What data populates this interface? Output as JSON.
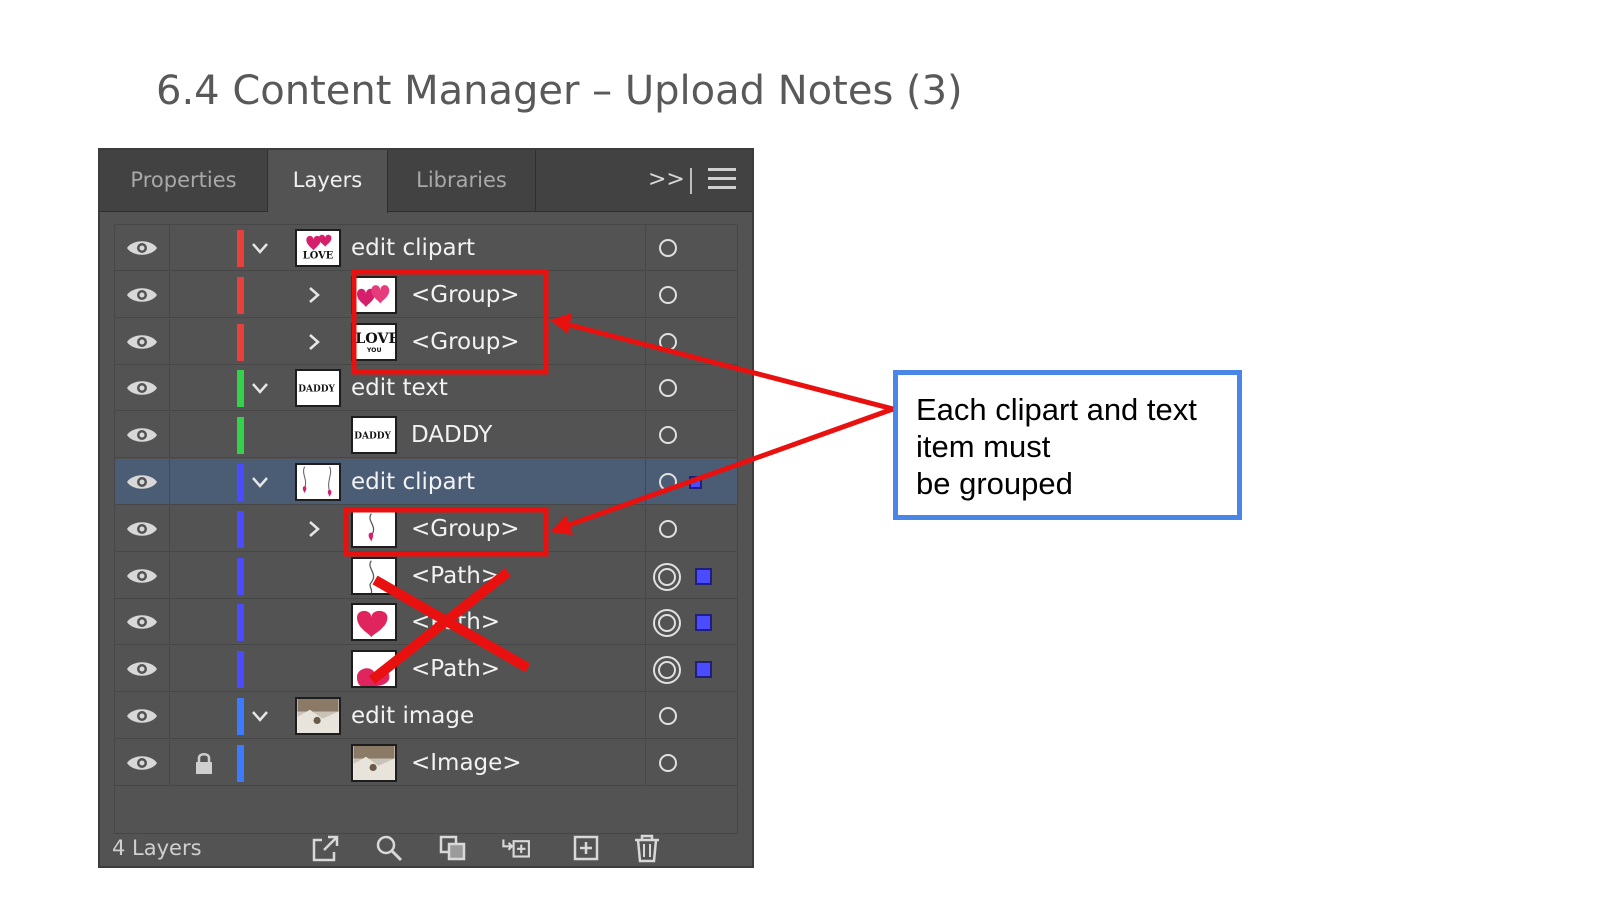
{
  "slide": {
    "title": "6.4 Content Manager – Upload Notes (3)"
  },
  "panel": {
    "tabs": [
      {
        "label": "Properties",
        "active": false
      },
      {
        "label": "Layers",
        "active": true
      },
      {
        "label": "Libraries",
        "active": false
      }
    ],
    "more_label": ">>",
    "menu_icon": "hamburger-menu-icon",
    "rows": [
      {
        "label": "edit clipart",
        "level": 0,
        "expanded": true,
        "color": "#e8413c",
        "thumb": "love-hearts",
        "target": "single",
        "selected": false,
        "locked": false
      },
      {
        "label": "<Group>",
        "level": 1,
        "expanded": false,
        "color": "#e8413c",
        "thumb": "pink-hearts",
        "target": "single",
        "selected": false,
        "locked": false
      },
      {
        "label": "<Group>",
        "level": 1,
        "expanded": false,
        "color": "#e8413c",
        "thumb": "love-text",
        "target": "single",
        "selected": false,
        "locked": false
      },
      {
        "label": "edit text",
        "level": 0,
        "expanded": true,
        "color": "#34d14a",
        "thumb": "daddy-text",
        "target": "single",
        "selected": false,
        "locked": false
      },
      {
        "label": "DADDY",
        "level": 1,
        "expanded": null,
        "color": "#34d14a",
        "thumb": "daddy-text",
        "target": "single",
        "selected": false,
        "locked": false
      },
      {
        "label": "edit clipart",
        "level": 0,
        "expanded": true,
        "color": "#4b4bff",
        "thumb": "hanging-hearts",
        "target": "single-selected",
        "selected": true,
        "locked": false
      },
      {
        "label": "<Group>",
        "level": 1,
        "expanded": false,
        "color": "#4b4bff",
        "thumb": "hanging-heart",
        "target": "single",
        "selected": false,
        "locked": false
      },
      {
        "label": "<Path>",
        "level": 1,
        "expanded": null,
        "color": "#4b4bff",
        "thumb": "string",
        "target": "double",
        "selected": false,
        "locked": false
      },
      {
        "label": "<Path>",
        "level": 1,
        "expanded": null,
        "color": "#4b4bff",
        "thumb": "heart",
        "target": "double",
        "selected": false,
        "locked": false
      },
      {
        "label": "<Path>",
        "level": 1,
        "expanded": null,
        "color": "#4b4bff",
        "thumb": "heart-partial",
        "target": "double",
        "selected": false,
        "locked": false
      },
      {
        "label": "edit image",
        "level": 0,
        "expanded": true,
        "color": "#3b7bff",
        "thumb": "photo",
        "target": "single",
        "selected": false,
        "locked": false
      },
      {
        "label": "<Image>",
        "level": 1,
        "expanded": null,
        "color": "#3b7bff",
        "thumb": "photo",
        "target": "single",
        "selected": false,
        "locked": true
      }
    ],
    "footer": {
      "count_label": "4 Layers",
      "icons": [
        "export-icon",
        "search-icon",
        "clipping-mask-icon",
        "move-to-layer-icon",
        "new-layer-icon",
        "trash-icon"
      ]
    }
  },
  "annotation": {
    "callout_lines": [
      "Each clipart and text",
      "item must",
      "be grouped"
    ],
    "highlight_color": "#e8110f",
    "callout_border_color": "#4a86e8",
    "cross_out": "x-mark"
  }
}
